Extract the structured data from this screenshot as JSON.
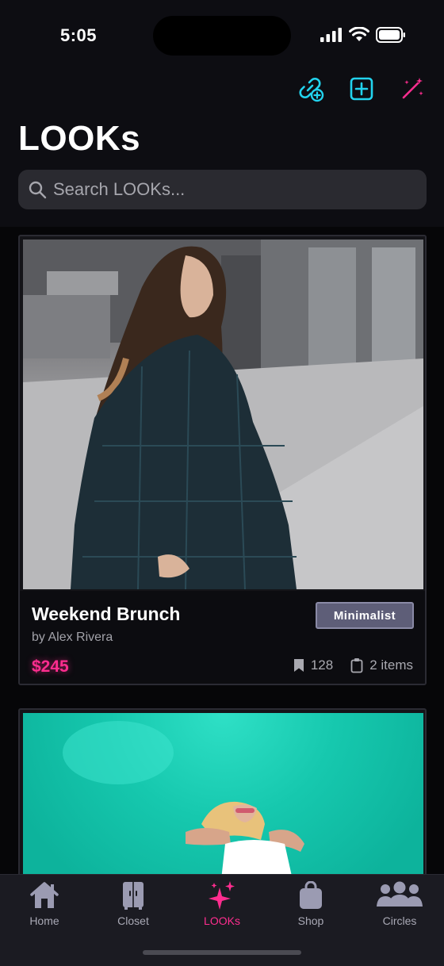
{
  "status": {
    "time": "5:05"
  },
  "header": {
    "title": "LOOKs",
    "search_placeholder": "Search LOOKs...",
    "actions": [
      "link-add-icon",
      "plus-square-icon",
      "magic-wand-icon"
    ],
    "accent_cyan": "#22d3ee",
    "accent_pink": "#ff2d8f"
  },
  "feed": {
    "cards": [
      {
        "title": "Weekend Brunch",
        "author": "by Alex Rivera",
        "price": "$245",
        "badge": "Minimalist",
        "saves": "128",
        "items": "2 items"
      }
    ]
  },
  "tabs": [
    {
      "label": "Home",
      "icon": "home-icon"
    },
    {
      "label": "Closet",
      "icon": "closet-icon"
    },
    {
      "label": "LOOKs",
      "icon": "sparkles-icon",
      "active": true
    },
    {
      "label": "Shop",
      "icon": "bag-icon"
    },
    {
      "label": "Circles",
      "icon": "people-icon"
    }
  ]
}
